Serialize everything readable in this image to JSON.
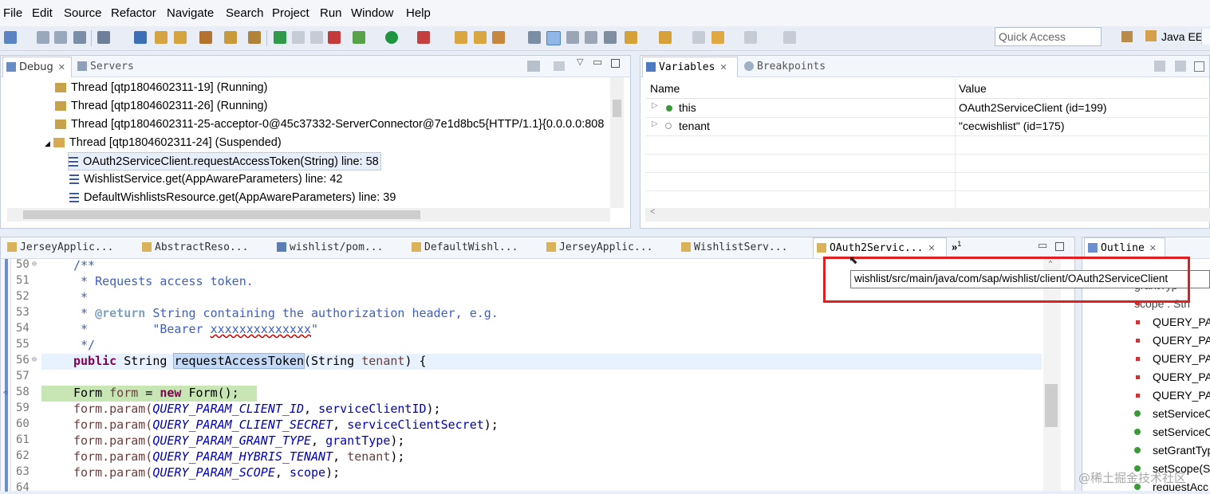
{
  "menu": [
    "File",
    "Edit",
    "Source",
    "Refactor",
    "Navigate",
    "Search",
    "Project",
    "Run",
    "Window",
    "Help"
  ],
  "quick_access": {
    "placeholder": "Quick Access"
  },
  "perspective": {
    "label": "Java EE"
  },
  "debug": {
    "tabs": [
      {
        "label": "Debug",
        "close": "☒"
      },
      {
        "label": "Servers"
      }
    ],
    "rows": [
      {
        "text": "Thread [qtp1804602311-19] (Running)"
      },
      {
        "text": "Thread [qtp1804602311-26] (Running)"
      },
      {
        "text": "Thread [qtp1804602311-25-acceptor-0@45c37332-ServerConnector@7e1d8bc5{HTTP/1.1}{0.0.0.0:808"
      },
      {
        "text": "Thread [qtp1804602311-24] (Suspended)"
      },
      {
        "text": "OAuth2ServiceClient.requestAccessToken(String) line: 58"
      },
      {
        "text": "WishlistService.get(AppAwareParameters) line: 42"
      },
      {
        "text": "DefaultWishlistsResource.get(AppAwareParameters) line: 39"
      }
    ]
  },
  "variables": {
    "tabs": [
      {
        "label": "Variables"
      },
      {
        "label": "Breakpoints"
      }
    ],
    "headers": {
      "name": "Name",
      "value": "Value"
    },
    "rows": [
      {
        "name": "this",
        "value": "OAuth2ServiceClient  (id=199)"
      },
      {
        "name": "tenant",
        "value": "\"cecwishlist\" (id=175)"
      }
    ]
  },
  "editor_tabs": [
    "JerseyApplic...",
    "AbstractReso...",
    "wishlist/pom...",
    "DefaultWishl...",
    "JerseyApplic...",
    "WishlistServ...",
    "OAuth2Servic..."
  ],
  "editor_tabs_overflow": "»",
  "editor_tabs_overflow_count": "1",
  "tooltip": "wishlist/src/main/java/com/sap/wishlist/client/OAuth2ServiceClient",
  "code": {
    "line_numbers": [
      "50",
      "51",
      "52",
      "53",
      "54",
      "55",
      "56",
      "57",
      "58",
      "59",
      "60",
      "61",
      "62",
      "63",
      "64"
    ],
    "l50": "/**",
    "l51": " * Requests access token.",
    "l52": " *",
    "l53_tag": "@return",
    "l53_rest": " String containing the authorization header, e.g.",
    "l54_a": " *         \"Bearer ",
    "l54_b": "xxxxxxxxxxxxxx",
    "l54_c": "\"",
    "l55": " */",
    "l56_kw": "public",
    "l56_type": " String ",
    "l56_name": "requestAccessToken",
    "l56_rest": "(String ",
    "l56_param": "tenant",
    "l56_end": ") {",
    "l58_a": "Form ",
    "l58_b": "form",
    "l58_c": " = ",
    "l58_kw": "new",
    "l58_d": " Form();",
    "params": [
      {
        "const": "QUERY_PARAM_CLIENT_ID",
        "arg": "serviceClientID",
        "argtype": "field"
      },
      {
        "const": "QUERY_PARAM_CLIENT_SECRET",
        "arg": "serviceClientSecret",
        "argtype": "field"
      },
      {
        "const": "QUERY_PARAM_GRANT_TYPE",
        "arg": "grantType",
        "argtype": "field"
      },
      {
        "const": "QUERY_PARAM_HYBRIS_TENANT",
        "arg": "tenant",
        "argtype": "var"
      },
      {
        "const": "QUERY_PARAM_SCOPE",
        "arg": "scope",
        "argtype": "field"
      }
    ],
    "prefix": "form.param(",
    "sep": ", ",
    "suffix": ");"
  },
  "outline": {
    "tab": "Outline",
    "items": [
      "grantTyp",
      "scope : Stri",
      "QUERY_PA",
      "QUERY_PA",
      "QUERY_PA",
      "QUERY_PA",
      "QUERY_PA",
      "setServiceC",
      "setServiceC",
      "setGrantTyp",
      "setScope(S",
      "requestAcc"
    ]
  },
  "watermark": "@稀土掘金技术社区",
  "colors": {
    "highlight_box": "#e02020",
    "selection": "#c3d9f5",
    "debug_line": "#c8e6b4",
    "current_line": "#e8f2fe"
  }
}
